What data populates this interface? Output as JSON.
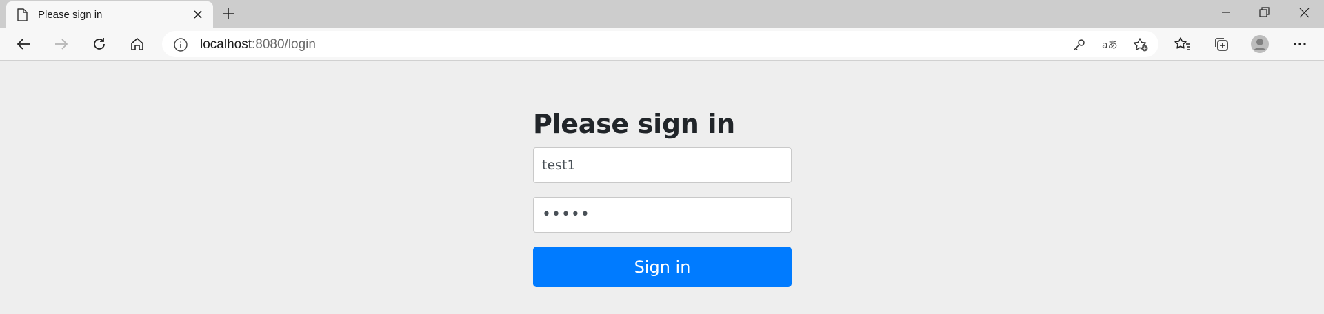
{
  "browser": {
    "tab": {
      "title": "Please sign in"
    },
    "address": {
      "host": "localhost",
      "rest": ":8080/login"
    }
  },
  "page": {
    "heading": "Please sign in",
    "username": {
      "value": "test1"
    },
    "password": {
      "masked": "•••••"
    },
    "submit_label": "Sign in",
    "accent_color": "#007bff"
  }
}
